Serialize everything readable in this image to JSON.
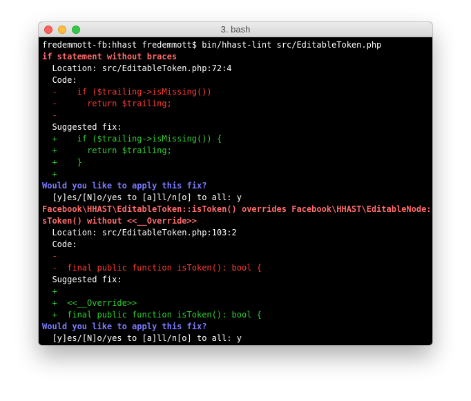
{
  "window": {
    "title": "3. bash"
  },
  "terminal": {
    "lines": [
      {
        "text": "fredemmott-fb:hhast fredemmott$ bin/hhast-lint src/EditableToken.php",
        "color": "white"
      },
      {
        "text": "if statement without braces",
        "color": "redbold"
      },
      {
        "text": "  Location: src/EditableToken.php:72:4",
        "color": "white"
      },
      {
        "text": "  Code:",
        "color": "white"
      },
      {
        "text": "  -    if ($trailing->isMissing())",
        "color": "red"
      },
      {
        "text": "  -      return $trailing;",
        "color": "red"
      },
      {
        "text": "  -",
        "color": "red"
      },
      {
        "text": "  Suggested fix:",
        "color": "white"
      },
      {
        "text": "  +    if ($trailing->isMissing()) {",
        "color": "green"
      },
      {
        "text": "  +      return $trailing;",
        "color": "green"
      },
      {
        "text": "  +    }",
        "color": "green"
      },
      {
        "text": "  +",
        "color": "green"
      },
      {
        "text": "Would you like to apply this fix?",
        "color": "blue"
      },
      {
        "text": "  [y]es/[N]o/yes to [a]ll/n[o] to all: y",
        "color": "white"
      },
      {
        "text": "Facebook\\HHAST\\EditableToken::isToken() overrides Facebook\\HHAST\\EditableNode::i",
        "color": "redbold"
      },
      {
        "text": "sToken() without <<__Override>>",
        "color": "redbold"
      },
      {
        "text": "  Location: src/EditableToken.php:103:2",
        "color": "white"
      },
      {
        "text": "  Code:",
        "color": "white"
      },
      {
        "text": "  -",
        "color": "red"
      },
      {
        "text": "  -  final public function isToken(): bool {",
        "color": "red"
      },
      {
        "text": "  Suggested fix:",
        "color": "white"
      },
      {
        "text": "  +",
        "color": "green"
      },
      {
        "text": "  +  <<__Override>>",
        "color": "green"
      },
      {
        "text": "  +  final public function isToken(): bool {",
        "color": "green"
      },
      {
        "text": "Would you like to apply this fix?",
        "color": "blue"
      },
      {
        "text": "  [y]es/[N]o/yes to [a]ll/n[o] to all: y",
        "color": "white"
      }
    ]
  },
  "colors": {
    "background": "#000000",
    "prompt_text": "#ffffff",
    "error_heading": "#ff6b6b",
    "removed_code": "#ff3b30",
    "added_code": "#2fd12f",
    "question": "#7b7bff"
  }
}
